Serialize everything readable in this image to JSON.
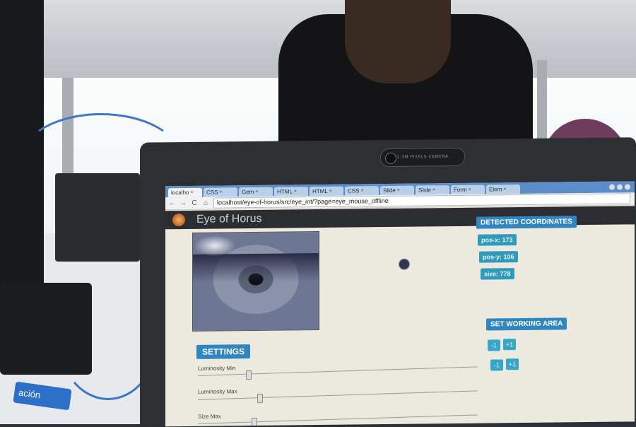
{
  "browser": {
    "tabs": [
      {
        "label": "localho",
        "active": true
      },
      {
        "label": "CSS",
        "active": false
      },
      {
        "label": "Gem",
        "active": false
      },
      {
        "label": "HTML",
        "active": false
      },
      {
        "label": "HTML",
        "active": false
      },
      {
        "label": "CSS",
        "active": false
      },
      {
        "label": "Slide",
        "active": false
      },
      {
        "label": "Slide",
        "active": false
      },
      {
        "label": "Form",
        "active": false
      },
      {
        "label": "Elem",
        "active": false
      }
    ],
    "tab_close": "×",
    "url": "localhost/eye-of-horus/src/eye_int/?page=eye_mouse_offline",
    "nav": {
      "back": "←",
      "forward": "→",
      "reload": "C",
      "home": "⌂"
    }
  },
  "app": {
    "title": "Eye of Horus",
    "detected_title": "DETECTED COORDINATES",
    "pos_x": "pos-x: 173",
    "pos_y": "pos-y: 106",
    "size": "size: 778",
    "working_area_title": "SET WORKING AREA",
    "working_area_buttons": [
      "-1",
      "+1",
      "-1",
      "+1"
    ],
    "settings_title": "SETTINGS",
    "sliders": [
      {
        "label": "Luminosity Min",
        "value": 0.18
      },
      {
        "label": "Luminosity Max",
        "value": 0.22
      },
      {
        "label": "Size Max",
        "value": 0.2
      }
    ]
  },
  "hardware": {
    "webcam_label": "1.3M PIXELS CAMERA"
  },
  "scene": {
    "lanyard_text": "ación"
  },
  "colors": {
    "badge": "#2f86c0",
    "pill": "#2f9abb",
    "screen_bg": "#eceadf",
    "tabstrip": "#5c8ecb"
  }
}
